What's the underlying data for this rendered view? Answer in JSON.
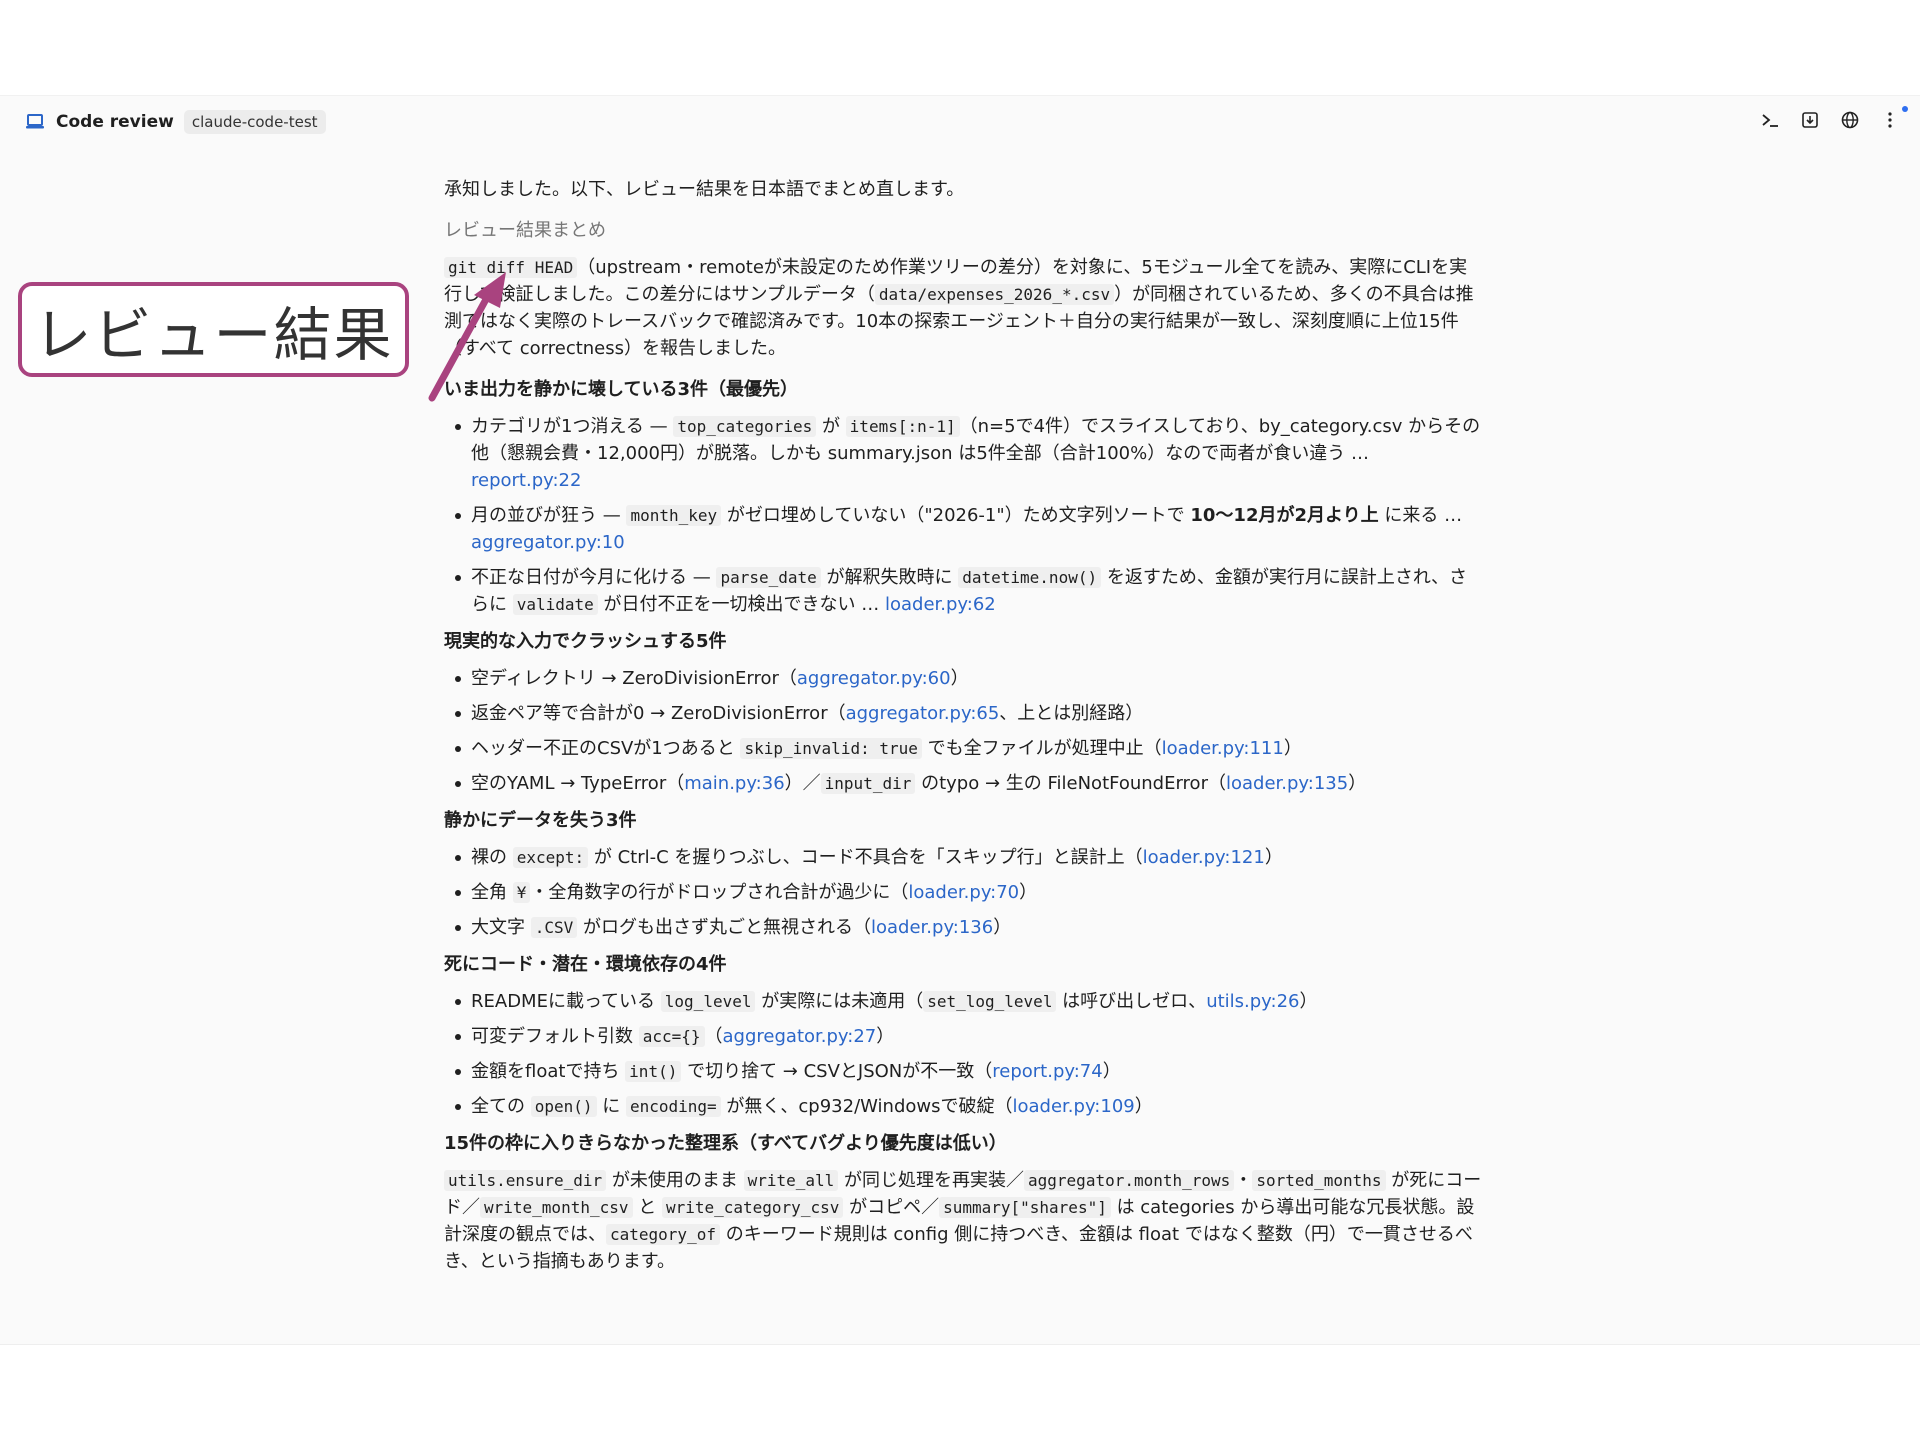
{
  "header": {
    "title": "Code review",
    "repo": "claude-code-test"
  },
  "callout": {
    "label": "レビュー結果"
  },
  "intro": "承知しました。以下、レビュー結果を日本語でまとめ直します。",
  "subtitle": "レビュー結果まとめ",
  "summary": {
    "code1": "git diff HEAD",
    "t1": "（upstream・remoteが未設定のため作業ツリーの差分）を対象に、5モジュール全てを読み、実際にCLIを実行して検証しました。この差分にはサンプルデータ（",
    "code2": "data/expenses_2026_*.csv",
    "t2": "）が同梱されているため、多くの不具合は推測ではなく実際のトレースバックで確認済みです。10本の探索エージェント＋自分の実行結果が一致し、深刻度順に上位15件（すべて correctness）を報告しました。"
  },
  "sections": {
    "s1": {
      "heading": "いま出力を静かに壊している3件（最優先）",
      "i1": {
        "t1": "カテゴリが1つ消える — ",
        "c1": "top_categories",
        "t2": " が ",
        "c2": "items[:n-1]",
        "t3": "（n=5で4件）でスライスしており、by_category.csv からその他（懇親会費・12,000円）が脱落。しかも summary.json は5件全部（合計100%）なので両者が食い違う … ",
        "link": "report.py:22"
      },
      "i2": {
        "t1": "月の並びが狂う — ",
        "c1": "month_key",
        "t2": " がゼロ埋めしていない（\"2026-1\"）ため文字列ソートで ",
        "b1": "10〜12月が2月より上",
        "t3": " に来る … ",
        "link": "aggregator.py:10"
      },
      "i3": {
        "t1": "不正な日付が今月に化ける — ",
        "c1": "parse_date",
        "t2": " が解釈失敗時に ",
        "c2": "datetime.now()",
        "t3": " を返すため、金額が実行月に誤計上され、さらに ",
        "c3": "validate",
        "t4": " が日付不正を一切検出できない … ",
        "link": "loader.py:62"
      }
    },
    "s2": {
      "heading": "現実的な入力でクラッシュする5件",
      "i1": {
        "t1": "空ディレクトリ → ZeroDivisionError（",
        "link": "aggregator.py:60",
        "t2": "）"
      },
      "i2": {
        "t1": "返金ペア等で合計が0 → ZeroDivisionError（",
        "link": "aggregator.py:65",
        "t2": "、上とは別経路）"
      },
      "i3": {
        "t1": "ヘッダー不正のCSVが1つあると ",
        "c1": "skip_invalid: true",
        "t2": " でも全ファイルが処理中止（",
        "link": "loader.py:111",
        "t3": "）"
      },
      "i4": {
        "t1": "空のYAML → TypeError（",
        "link1": "main.py:36",
        "t2": "）／",
        "c1": "input_dir",
        "t3": " のtypo → 生の FileNotFoundError（",
        "link2": "loader.py:135",
        "t4": "）"
      }
    },
    "s3": {
      "heading": "静かにデータを失う3件",
      "i1": {
        "t1": "裸の ",
        "c1": "except:",
        "t2": " が Ctrl-C を握りつぶし、コード不具合を「スキップ行」と誤計上（",
        "link": "loader.py:121",
        "t3": "）"
      },
      "i2": {
        "t1": "全角 ",
        "c1": "¥",
        "t2": "・全角数字の行がドロップされ合計が過少に（",
        "link": "loader.py:70",
        "t3": "）"
      },
      "i3": {
        "t1": "大文字 ",
        "c1": ".CSV",
        "t2": " がログも出さず丸ごと無視される（",
        "link": "loader.py:136",
        "t3": "）"
      }
    },
    "s4": {
      "heading": "死にコード・潜在・環境依存の4件",
      "i1": {
        "t1": "READMEに載っている ",
        "c1": "log_level",
        "t2": " が実際には未適用（",
        "c2": "set_log_level",
        "t3": " は呼び出しゼロ、",
        "link": "utils.py:26",
        "t4": "）"
      },
      "i2": {
        "t1": "可変デフォルト引数 ",
        "c1": "acc={}",
        "t2": "（",
        "link": "aggregator.py:27",
        "t3": "）"
      },
      "i3": {
        "t1": "金額をfloatで持ち ",
        "c1": "int()",
        "t2": " で切り捨て → CSVとJSONが不一致（",
        "link": "report.py:74",
        "t3": "）"
      },
      "i4": {
        "t1": "全ての ",
        "c1": "open()",
        "t2": " に ",
        "c2": "encoding=",
        "t3": " が無く、cp932/Windowsで破綻（",
        "link": "loader.py:109",
        "t4": "）"
      }
    },
    "s5": {
      "heading": "15件の枠に入りきらなかった整理系（すべてバグより優先度は低い）",
      "c1": "utils.ensure_dir",
      "t1": " が未使用のまま ",
      "c2": "write_all",
      "t2": " が同じ処理を再実装／",
      "c3": "aggregator.month_rows",
      "t3": "・",
      "c4": "sorted_months",
      "t4": " が死にコード／",
      "c5": "write_month_csv",
      "t5": " と ",
      "c6": "write_category_csv",
      "t6": " がコピペ／",
      "c7": "summary[\"shares\"]",
      "t7": " は categories から導出可能な冗長状態。設計深度の観点では、",
      "c8": "category_of",
      "t8": " のキーワード規則は config 側に持つべき、金額は float ではなく整数（円）で一貫させるべき、という指摘もあります。"
    }
  },
  "colors": {
    "accent": "#a9437f",
    "link": "#2b66c8"
  }
}
